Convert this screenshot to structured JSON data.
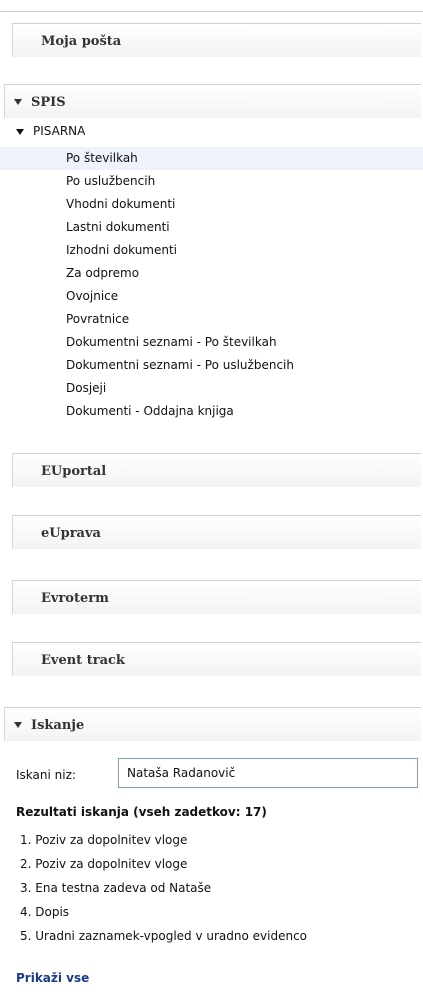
{
  "panels": {
    "moja_posta": "Moja pošta",
    "spis": "SPIS",
    "euportal": "EUportal",
    "euprava": "eUprava",
    "evroterm": "Evroterm",
    "event_track": "Event track",
    "iskanje": "Iskanje"
  },
  "tree": {
    "root": "PISARNA",
    "items": [
      "Po številkah",
      "Po uslužbencih",
      "Vhodni dokumenti",
      "Lastni dokumenti",
      "Izhodni dokumenti",
      "Za odpremo",
      "Ovojnice",
      "Povratnice",
      "Dokumentni seznami - Po številkah",
      "Dokumentni seznami - Po uslužbencih",
      "Dosjeji",
      "Dokumenti  - Oddajna knjiga"
    ],
    "selected_index": 0
  },
  "search": {
    "label": "Iskani niz:",
    "value": "Nataša Radanovič",
    "results_title": "Rezultati iskanja (vseh zadetkov: 17)",
    "results": [
      "1. Poziv za dopolnitev vloge",
      "2. Poziv za dopolnitev vloge",
      "3. Ena testna zadeva od Nataše",
      "4. Dopis",
      "5. Uradni zaznamek-vpogled v uradno evidenco"
    ],
    "show_all": "Prikaži vse"
  }
}
